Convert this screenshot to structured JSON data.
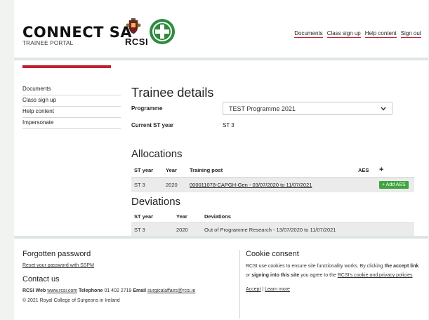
{
  "brand": {
    "title": "CONNECT SA",
    "subtitle": "TRAINEE PORTAL",
    "rcsi_text": "RCSI"
  },
  "topnav": [
    "Documents",
    "Class sign up",
    "Help content",
    "Sign out"
  ],
  "sidebar": [
    "Documents",
    "Class sign up",
    "Help content",
    "Impersonate"
  ],
  "trainee": {
    "heading": "Trainee details",
    "programme_label": "Programme",
    "programme_value": "TEST Programme 2021",
    "st_year_label": "Current ST year",
    "st_year_value": "ST 3"
  },
  "allocations": {
    "heading": "Allocations",
    "columns": [
      "ST year",
      "Year",
      "Training post",
      "AES",
      "+"
    ],
    "rows": [
      {
        "st_year": "ST 3",
        "year": "2020",
        "post": "000011078-CAPGH-Gen - 03/07/2020 to 11/07/2021",
        "action": "+ Add AES"
      }
    ]
  },
  "deviations": {
    "heading": "Deviations",
    "columns": [
      "ST year",
      "Year",
      "Deviations"
    ],
    "rows": [
      {
        "st_year": "ST 3",
        "year": "2020",
        "deviation": "Out of Programme Research - 13/07/2020 to 11/07/2021"
      }
    ]
  },
  "footer": {
    "forgotten_heading": "Forgotten password",
    "reset_link": "Reset your password with SSPM",
    "contact_heading": "Contact us",
    "contact_web_label": "RCSI Web",
    "contact_web": "www.rcsi.com",
    "contact_phone_label": "Telephone",
    "contact_phone": "01 402 2719",
    "contact_email_label": "Email",
    "contact_email": "surgicalaffairs@rcsi.ie",
    "copyright": "© 2021 Royal College of Surgeons in Ireland",
    "cookie_heading": "Cookie consent",
    "cookie_text_1": "RCSI use cookies to ensure site functionality works. By clicking",
    "cookie_text_2a": "the accept link",
    "cookie_text_2b": "or",
    "cookie_text_2c": "signing into this site",
    "cookie_text_2d": "you agree to the",
    "cookie_link": "RCSI's cookie and privacy policies",
    "accept": "Accept",
    "sep": "|",
    "learn_more": "Learn more"
  },
  "colors": {
    "accent_red": "#c0202e",
    "add_green": "#3ea63e",
    "divider": "#dfe6e0"
  }
}
